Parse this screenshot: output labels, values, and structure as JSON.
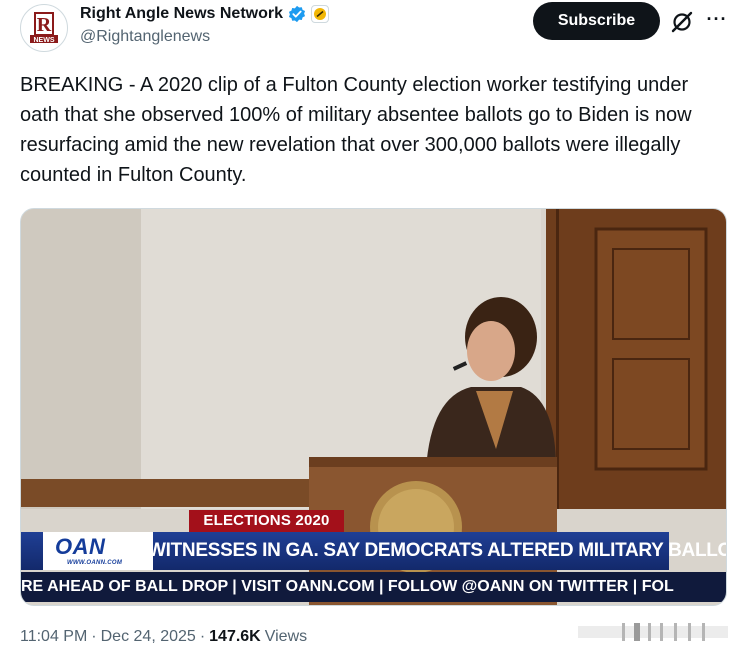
{
  "author": {
    "display_name": "Right Angle News Network",
    "handle": "@Rightanglenews",
    "avatar_icon": "rightangle-news-logo",
    "avatar_letters": "R",
    "avatar_sub": "NEWS",
    "verified_icon": "verified-badge-icon",
    "affiliation_icon": "affiliate-badge-icon"
  },
  "actions": {
    "subscribe_label": "Subscribe",
    "grok_icon": "grok-icon",
    "more_icon": "more-icon"
  },
  "tweet": {
    "text": "BREAKING - A 2020 clip of a Fulton County election worker testifying under oath that she observed 100% of military absentee ballots go to Biden is now resurfacing amid the new revelation that over 300,000 ballots were illegally counted in Fulton County."
  },
  "media": {
    "type": "video-still",
    "banner_top": "ELECTIONS 2020",
    "network_logo": "OAN",
    "network_url": "WWW.OANN.COM",
    "headline": "WITNESSES IN GA. SAY DEMOCRATS ALTERED MILITARY BALLOTS",
    "ticker": "RE AHEAD OF BALL DROP  |  VISIT OANN.COM  |  FOLLOW @OANN ON TWITTER  |  FOL"
  },
  "meta": {
    "time": "11:04 PM",
    "separator": "·",
    "date": "Dec 24, 2025",
    "views_count": "147.6K",
    "views_label": "Views"
  },
  "colors": {
    "text_primary": "#0f1419",
    "text_secondary": "#536471",
    "verified_blue": "#1d9bf0",
    "subscribe_bg": "#0f1419",
    "oan_blue": "#1f3f95",
    "oan_red": "#a3101a"
  }
}
